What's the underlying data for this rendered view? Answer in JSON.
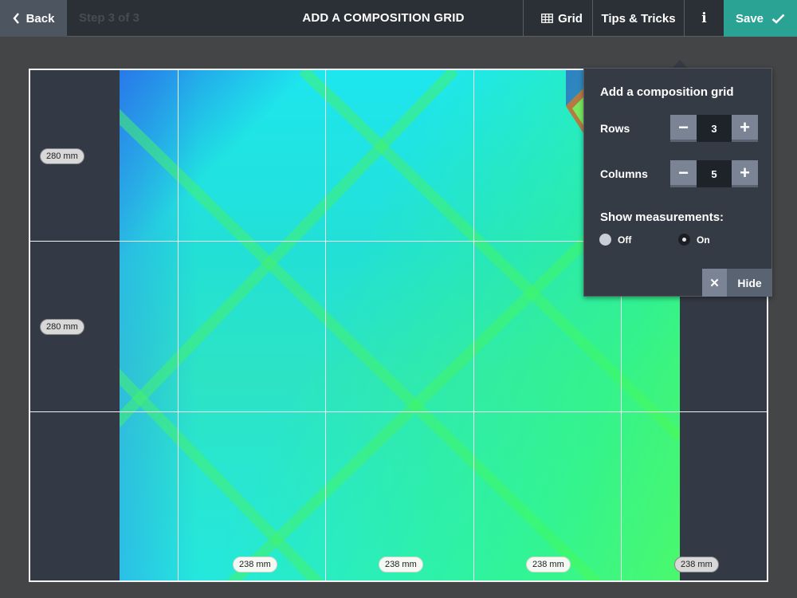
{
  "topbar": {
    "back_label": "Back",
    "step_text": "Step 3 of 3",
    "title": "ADD A COMPOSITION GRID",
    "grid_label": "Grid",
    "tips_label": "Tips & Tricks",
    "info_label": "i",
    "save_label": "Save"
  },
  "canvas": {
    "row_measurements": [
      "280 mm",
      "280 mm"
    ],
    "column_measurements": [
      "238 mm",
      "238 mm",
      "238 mm",
      "238 mm"
    ]
  },
  "popover": {
    "title": "Add a composition grid",
    "rows_label": "Rows",
    "rows_value": "3",
    "columns_label": "Columns",
    "columns_value": "5",
    "show_measurements_label": "Show measurements:",
    "off_label": "Off",
    "on_label": "On",
    "selected": "On",
    "hide_label": "Hide"
  },
  "colors": {
    "accent": "#2aa394",
    "topbar": "#2b2f36",
    "panel": "#353b45"
  }
}
